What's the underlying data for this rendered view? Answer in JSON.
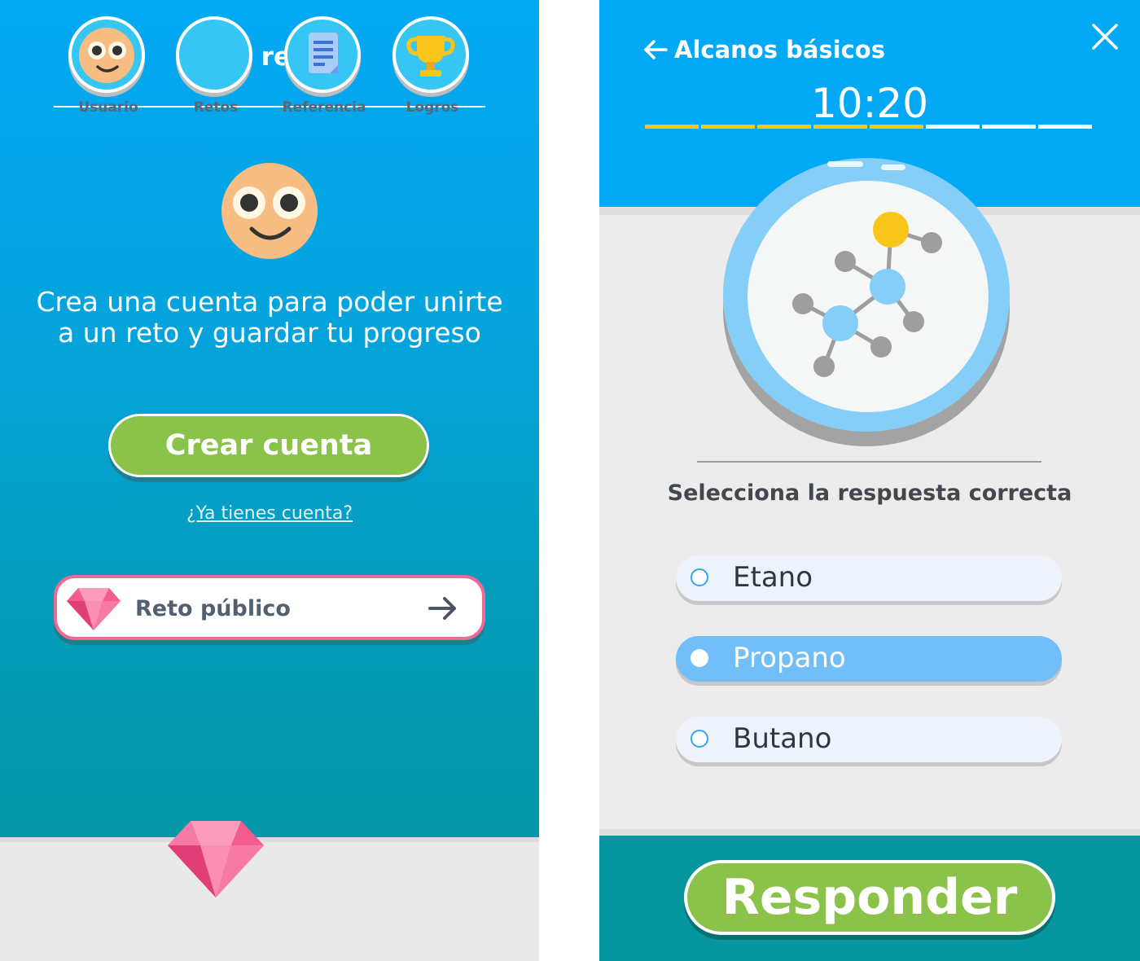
{
  "left": {
    "title": "Los retos",
    "message": "Crea una cuenta para poder unirte a un reto y guardar tu progreso",
    "create_account_label": "Crear cuenta",
    "login_link": "¿Ya tienes cuenta?",
    "public_challenge_label": "Reto público",
    "nav": [
      {
        "label": "Usuario",
        "icon": "face-icon"
      },
      {
        "label": "Retos",
        "icon": "gem-icon"
      },
      {
        "label": "Referencia",
        "icon": "document-icon"
      },
      {
        "label": "Logros",
        "icon": "trophy-icon"
      }
    ],
    "active_nav": "Retos"
  },
  "right": {
    "lesson_title": "Alcanos básicos",
    "timer": "10:20",
    "progress": {
      "segments": 8,
      "completed": 5
    },
    "question": "Selecciona la respuesta correcta",
    "options": [
      "Etano",
      "Propano",
      "Butano"
    ],
    "selected_option": "Propano",
    "answer_label": "Responder"
  },
  "colors": {
    "primary_blue": "#03a9f4",
    "teal": "#05959f",
    "green_button": "#8bc34a",
    "pink_accent": "#ee6a94",
    "progress_done": "#f9c51b",
    "selected_option": "#72bef9"
  }
}
